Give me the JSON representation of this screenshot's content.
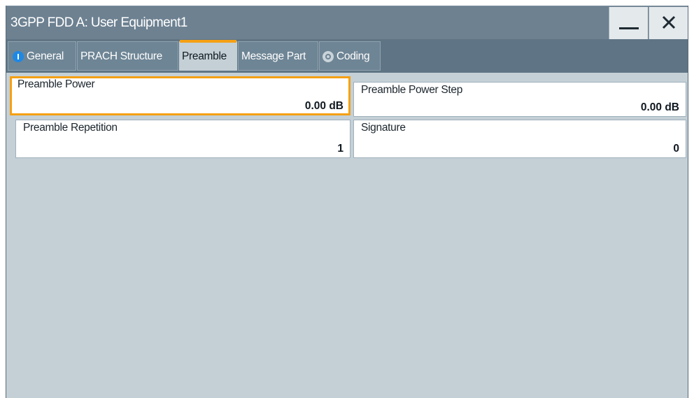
{
  "window": {
    "title": "3GPP FDD A: User Equipment1",
    "minimize_label": "minimize",
    "close_label": "close"
  },
  "tabs": [
    {
      "label": "General",
      "icon": "info-icon"
    },
    {
      "label": "PRACH Structure"
    },
    {
      "label": "Preamble",
      "active": true
    },
    {
      "label": "Message Part"
    },
    {
      "label": "Coding",
      "icon": "radio-ring-icon"
    }
  ],
  "fields": {
    "preamble_power": {
      "label": "Preamble Power",
      "value": "0.00 dB"
    },
    "preamble_power_step": {
      "label": "Preamble Power Step",
      "value": "0.00 dB"
    },
    "preamble_repetition": {
      "label": "Preamble Repetition",
      "value": "1"
    },
    "signature": {
      "label": "Signature",
      "value": "0"
    }
  },
  "colors": {
    "titlebar": "#6d8191",
    "tabbar": "#5f7585",
    "panel": "#c4d0d6",
    "accent": "#f5a014",
    "info_icon": "#1e88e5"
  }
}
